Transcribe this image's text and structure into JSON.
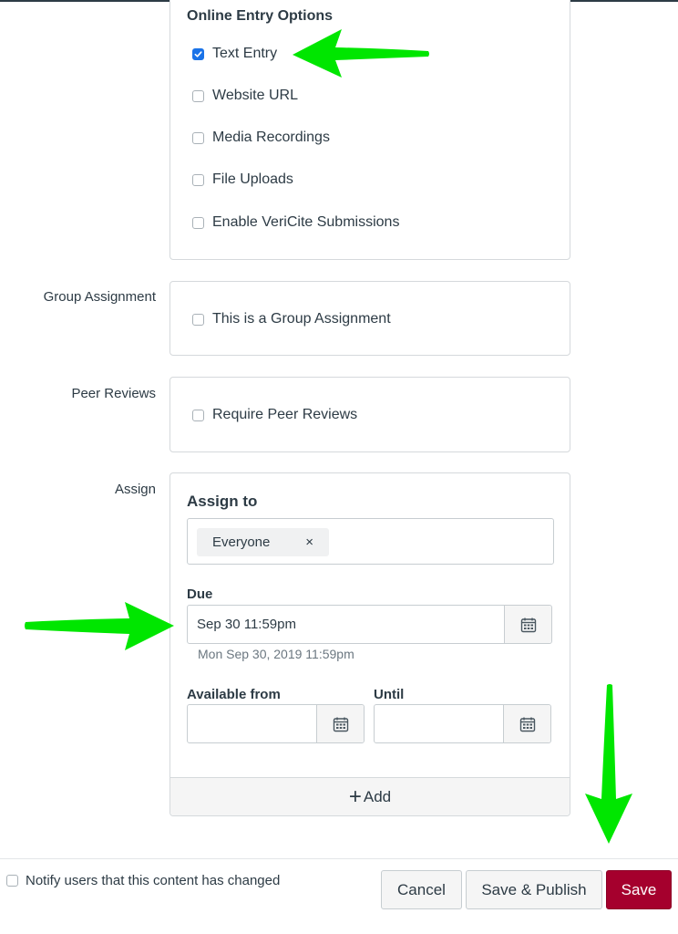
{
  "online_entry": {
    "title": "Online Entry Options",
    "options": [
      {
        "label": "Text Entry",
        "checked": true
      },
      {
        "label": "Website URL",
        "checked": false
      },
      {
        "label": "Media Recordings",
        "checked": false
      },
      {
        "label": "File Uploads",
        "checked": false
      },
      {
        "label": "Enable VeriCite Submissions",
        "checked": false
      }
    ]
  },
  "group_assignment": {
    "label": "Group Assignment",
    "option": {
      "label": "This is a Group Assignment",
      "checked": false
    }
  },
  "peer_reviews": {
    "label": "Peer Reviews",
    "option": {
      "label": "Require Peer Reviews",
      "checked": false
    }
  },
  "assign": {
    "label": "Assign",
    "assign_to_title": "Assign to",
    "assignees": [
      {
        "label": "Everyone",
        "remove_glyph": "×"
      }
    ],
    "due": {
      "label": "Due",
      "value": "Sep 30 11:59pm",
      "hint": "Mon Sep 30, 2019 11:59pm"
    },
    "available_from": {
      "label": "Available from",
      "value": ""
    },
    "until": {
      "label": "Until",
      "value": ""
    },
    "add_label": "Add",
    "add_glyph": "+"
  },
  "footer": {
    "notify": {
      "label": "Notify users that this content has changed",
      "checked": false
    },
    "cancel_label": "Cancel",
    "save_publish_label": "Save & Publish",
    "save_label": "Save"
  },
  "colors": {
    "text": "#2d3b45",
    "checkbox_checked": "#1a73e8",
    "save_button": "#a5002d",
    "annotation_arrow": "#00e600"
  },
  "annotations": [
    {
      "type": "arrow",
      "points_to": "Text Entry checkbox"
    },
    {
      "type": "arrow",
      "points_to": "Due date input"
    },
    {
      "type": "arrow",
      "points_to": "Save button"
    }
  ]
}
